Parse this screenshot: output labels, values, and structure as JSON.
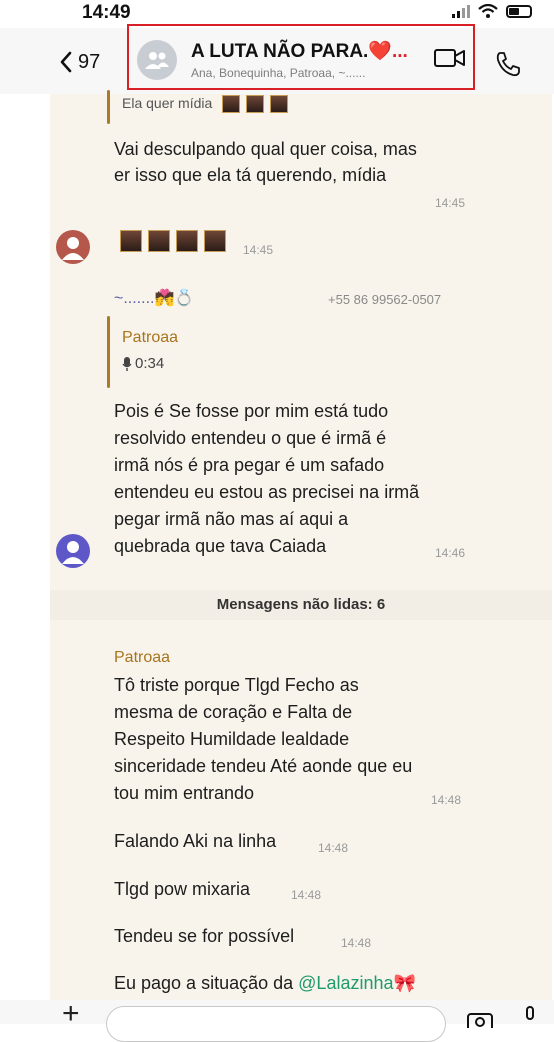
{
  "status_bar": {
    "time": "14:49"
  },
  "header": {
    "back_count": "97",
    "group_name": "A LUTA NÃO PARA.",
    "group_name_emoji": "❤️...",
    "members": "Ana, Bonequinha, Patroaa, ~......"
  },
  "messages": {
    "quote_top": "Ela quer mídia",
    "msg1_line1": "Vai desculpando qual quer coisa, mas",
    "msg1_line2": "er isso que ela tá querendo, mídia",
    "msg1_time": "14:45",
    "msg2_time": "14:45",
    "msg3_sender": "~.......💏💍",
    "msg3_phone": "+55 86 99562-0507",
    "msg3_quote_sender": "Patroaa",
    "msg3_quote_audio": "0:34",
    "msg3_lines": [
      "Pois é Se fosse por mim está tudo",
      "resolvido entendeu o que é irmã é",
      "irmã nós é pra pegar é um safado",
      "entendeu eu estou as precisei na irmã",
      "pegar irmã não mas aí aqui a",
      "quebrada que tava Caiada"
    ],
    "msg3_time": "14:46",
    "unread_label": "Mensagens não lidas: 6",
    "msg4_sender": "Patroaa",
    "msg4_lines": [
      "Tô triste porque Tlgd Fecho as",
      "mesma de coração e Falta de",
      "Respeito Humildade lealdade",
      "sinceridade tendeu Até aonde que eu",
      "tou mim entrando"
    ],
    "msg4_time": "14:48",
    "msg5": "Falando Aki na linha",
    "msg5_time": "14:48",
    "msg6": "Tlgd pow mixaria",
    "msg6_time": "14:48",
    "msg7": "Tendeu se for possível",
    "msg7_time": "14:48",
    "msg8_prefix": "Eu pago a situação da",
    "msg8_mention": "@Lalazinha🎀"
  },
  "colors": {
    "accent_gold": "#a8741c",
    "highlight_box": "#d81f26",
    "mention": "#1f9a6a"
  }
}
